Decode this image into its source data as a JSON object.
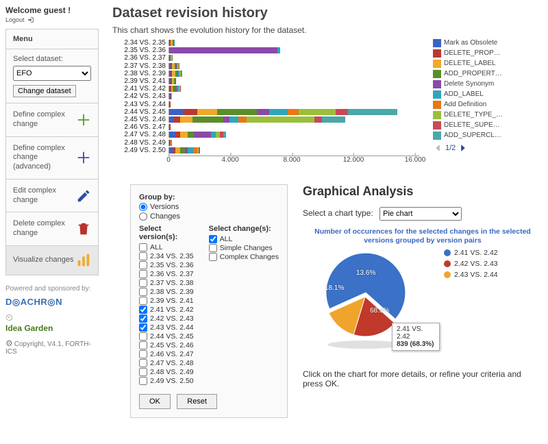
{
  "welcome": "Welcome guest !",
  "logout": "Logout",
  "menu": {
    "title": "Menu",
    "selectLabel": "Select dataset:",
    "selectedDataset": "EFO",
    "changeBtn": "Change dataset",
    "items": [
      {
        "label": "Define complex change",
        "icon": "plus-green"
      },
      {
        "label": "Define complex change (advanced)",
        "icon": "plus-purple"
      },
      {
        "label": "Edit complex change",
        "icon": "edit"
      },
      {
        "label": "Delete complex change",
        "icon": "trash"
      },
      {
        "label": "Visualize changes",
        "icon": "bars",
        "active": true
      }
    ]
  },
  "footer": {
    "poweredBy": "Powered and sponsored by:",
    "brand1a": "D",
    "brand1b": "ACHR",
    "brand1c": "N",
    "brandO": "◎",
    "brand2": "Idea Garden",
    "copyright": "Copyright, V4.1, FORTH-ICS"
  },
  "page": {
    "title": "Dataset revision history",
    "subtitle": "This chart shows the evolution history for the dataset."
  },
  "chart_data": [
    {
      "type": "bar",
      "title": "Dataset revision history",
      "xlabel": "",
      "ylabel": "",
      "xlim": [
        0,
        16000
      ],
      "ticks": [
        0,
        4000,
        8000,
        12000,
        16000
      ],
      "categories": [
        "2.34 VS. 2.35",
        "2.35 VS. 2.36",
        "2.36 VS. 2.37",
        "2.37 VS. 2.38",
        "2.38 VS. 2.39",
        "2.39 VS. 2.41",
        "2.41 VS. 2.42",
        "2.42 VS. 2.43",
        "2.43 VS. 2.44",
        "2.44 VS. 2.45",
        "2.45 VS. 2.46",
        "2.46 VS. 2.47",
        "2.47 VS. 2.48",
        "2.48 VS. 2.49",
        "2.49 VS. 2.50"
      ],
      "series": [
        {
          "name": "Mark as Obsolete",
          "color": "#3b63c4"
        },
        {
          "name": "DELETE_PROP…",
          "color": "#b83a34"
        },
        {
          "name": "DELETE_LABEL",
          "color": "#f0a92b"
        },
        {
          "name": "ADD_PROPERT…",
          "color": "#5a8e2a"
        },
        {
          "name": "Delete Synonym",
          "color": "#8a4aa8"
        },
        {
          "name": "ADD_LABEL",
          "color": "#2fa6b8"
        },
        {
          "name": "Add Definition",
          "color": "#e67817"
        },
        {
          "name": "DELETE_TYPE_…",
          "color": "#9bbf3a"
        },
        {
          "name": "DELETE_SUPE…",
          "color": "#c74a57"
        },
        {
          "name": "ADD_SUPERCL…",
          "color": "#4aa8a8"
        }
      ],
      "stacks": [
        [
          [
            40,
            "#3b63c4"
          ],
          [
            60,
            "#b83a34"
          ],
          [
            120,
            "#f0a92b"
          ],
          [
            100,
            "#5a8e2a"
          ],
          [
            40,
            "#2fa6b8"
          ]
        ],
        [
          [
            7000,
            "#8a4aa8"
          ],
          [
            200,
            "#2fa6b8"
          ]
        ],
        [
          [
            70,
            "#3b63c4"
          ],
          [
            40,
            "#b83a34"
          ],
          [
            60,
            "#f0a92b"
          ],
          [
            40,
            "#5a8e2a"
          ]
        ],
        [
          [
            80,
            "#3b63c4"
          ],
          [
            80,
            "#b83a34"
          ],
          [
            200,
            "#f0a92b"
          ],
          [
            80,
            "#5a8e2a"
          ],
          [
            40,
            "#8a4aa8"
          ],
          [
            60,
            "#2fa6b8"
          ],
          [
            80,
            "#9bbf3a"
          ],
          [
            40,
            "#c74a57"
          ]
        ],
        [
          [
            80,
            "#3b63c4"
          ],
          [
            100,
            "#b83a34"
          ],
          [
            220,
            "#f0a92b"
          ],
          [
            120,
            "#5a8e2a"
          ],
          [
            60,
            "#8a4aa8"
          ],
          [
            80,
            "#2fa6b8"
          ],
          [
            100,
            "#9bbf3a"
          ],
          [
            60,
            "#c74a57"
          ],
          [
            40,
            "#4aa8a8"
          ]
        ],
        [
          [
            100,
            "#3b63c4"
          ],
          [
            80,
            "#b83a34"
          ],
          [
            120,
            "#f0a92b"
          ],
          [
            80,
            "#5a8e2a"
          ],
          [
            40,
            "#8a4aa8"
          ]
        ],
        [
          [
            60,
            "#3b63c4"
          ],
          [
            60,
            "#b83a34"
          ],
          [
            120,
            "#f0a92b"
          ],
          [
            160,
            "#5a8e2a"
          ],
          [
            100,
            "#8a4aa8"
          ],
          [
            120,
            "#2fa6b8"
          ],
          [
            80,
            "#9bbf3a"
          ],
          [
            60,
            "#c74a57"
          ]
        ],
        [
          [
            80,
            "#3b63c4"
          ],
          [
            40,
            "#b83a34"
          ],
          [
            60,
            "#f0a92b"
          ]
        ],
        [
          [
            30,
            "#3b63c4"
          ],
          [
            20,
            "#b83a34"
          ]
        ],
        [
          [
            900,
            "#3b63c4"
          ],
          [
            900,
            "#b83a34"
          ],
          [
            1300,
            "#f0a92b"
          ],
          [
            2600,
            "#5a8e2a"
          ],
          [
            800,
            "#8a4aa8"
          ],
          [
            1200,
            "#2fa6b8"
          ],
          [
            700,
            "#e67817"
          ],
          [
            2400,
            "#9bbf3a"
          ],
          [
            800,
            "#c74a57"
          ],
          [
            3200,
            "#4aa8a8"
          ]
        ],
        [
          [
            300,
            "#3b63c4"
          ],
          [
            400,
            "#b83a34"
          ],
          [
            800,
            "#f0a92b"
          ],
          [
            2000,
            "#5a8e2a"
          ],
          [
            400,
            "#8a4aa8"
          ],
          [
            600,
            "#2fa6b8"
          ],
          [
            500,
            "#e67817"
          ],
          [
            4400,
            "#9bbf3a"
          ],
          [
            500,
            "#c74a57"
          ],
          [
            1500,
            "#4aa8a8"
          ]
        ],
        [
          [
            40,
            "#3b63c4"
          ],
          [
            30,
            "#b83a34"
          ]
        ],
        [
          [
            400,
            "#3b63c4"
          ],
          [
            300,
            "#b83a34"
          ],
          [
            500,
            "#f0a92b"
          ],
          [
            400,
            "#5a8e2a"
          ],
          [
            1100,
            "#8a4aa8"
          ],
          [
            300,
            "#2fa6b8"
          ],
          [
            300,
            "#9bbf3a"
          ],
          [
            200,
            "#c74a57"
          ],
          [
            200,
            "#4aa8a8"
          ]
        ],
        [
          [
            60,
            "#3b63c4"
          ],
          [
            40,
            "#b83a34"
          ],
          [
            40,
            "#f0a92b"
          ],
          [
            60,
            "#5a8e2a"
          ]
        ],
        [
          [
            200,
            "#3b63c4"
          ],
          [
            200,
            "#b83a34"
          ],
          [
            300,
            "#f0a92b"
          ],
          [
            300,
            "#5a8e2a"
          ],
          [
            200,
            "#8a4aa8"
          ],
          [
            400,
            "#2fa6b8"
          ],
          [
            200,
            "#e67817"
          ],
          [
            100,
            "#9bbf3a"
          ],
          [
            100,
            "#c74a57"
          ]
        ]
      ],
      "pager": "1/2"
    },
    {
      "type": "pie",
      "title": "Number of occurences for the selected changes in the selected versions grouped by version pairs",
      "categories": [
        "2.41 VS. 2.42",
        "2.42 VS. 2.43",
        "2.43 VS. 2.44"
      ],
      "values": [
        68.3,
        18.1,
        13.6
      ],
      "valueLabels": [
        "68.3%",
        "18.1%",
        "13.6%"
      ],
      "colors": [
        "#3b71c7",
        "#c0392b",
        "#f1a42b"
      ],
      "tooltip": {
        "line1": "2.41 VS. 2.42",
        "line2": "839 (68.3%)"
      }
    }
  ],
  "filter": {
    "groupBy": "Group by:",
    "radioVersions": "Versions",
    "radioChanges": "Changes",
    "versionsHead": "Select version(s):",
    "changesHead": "Select change(s):",
    "all": "ALL",
    "versions": [
      "2.34 VS. 2.35",
      "2.35 VS. 2.36",
      "2.36 VS. 2.37",
      "2.37 VS. 2.38",
      "2.38 VS. 2.39",
      "2.39 VS. 2.41",
      "2.41 VS. 2.42",
      "2.42 VS. 2.43",
      "2.43 VS. 2.44",
      "2.44 VS. 2.45",
      "2.45 VS. 2.46",
      "2.46 VS. 2.47",
      "2.47 VS. 2.48",
      "2.48 VS. 2.49",
      "2.49 VS. 2.50"
    ],
    "checkedVersions": [
      "2.41 VS. 2.42",
      "2.42 VS. 2.43",
      "2.43 VS. 2.44"
    ],
    "changes": [
      "Simple Changes",
      "Complex Changes"
    ],
    "ok": "OK",
    "reset": "Reset"
  },
  "analysis": {
    "heading": "Graphical Analysis",
    "chartTypeLabel": "Select a chart type:",
    "chartType": "Pie chart",
    "footnote": "Click on the chart for more details, or refine your criteria and press OK."
  }
}
